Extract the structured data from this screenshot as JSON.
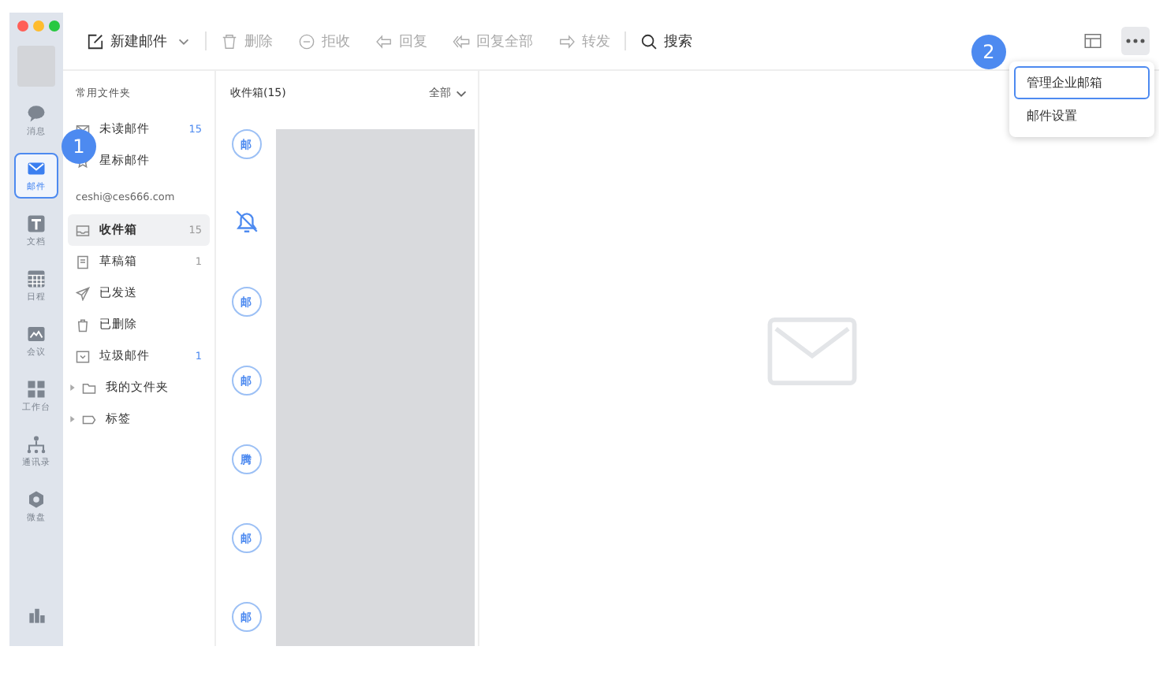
{
  "nav": [
    {
      "kind": "avatar"
    },
    {
      "kind": "chat",
      "label": "消息",
      "selected": false
    },
    {
      "kind": "mail",
      "label": "邮件",
      "selected": true
    },
    {
      "kind": "doc",
      "label": "文档",
      "selected": false
    },
    {
      "kind": "calendar",
      "label": "日程",
      "selected": false
    },
    {
      "kind": "meeting",
      "label": "会议",
      "selected": false
    },
    {
      "kind": "apps",
      "label": "工作台",
      "selected": false
    },
    {
      "kind": "contacts",
      "label": "通讯录",
      "selected": false
    },
    {
      "kind": "drive",
      "label": "微盘",
      "selected": false
    }
  ],
  "toolbar": {
    "compose": "新建邮件",
    "actions": [
      {
        "kind": "trash",
        "label": "删除",
        "disabled": true
      },
      {
        "kind": "block",
        "label": "拒收",
        "disabled": true
      },
      {
        "kind": "reply",
        "label": "回复",
        "disabled": true
      },
      {
        "kind": "replyall",
        "label": "回复全部",
        "disabled": true
      },
      {
        "kind": "forward",
        "label": "转发",
        "disabled": true
      }
    ],
    "search": "搜索"
  },
  "folders": {
    "common_heading": "常用文件夹",
    "common": [
      {
        "kind": "unread",
        "label": "未读邮件",
        "count": "15",
        "selected": false
      },
      {
        "kind": "star",
        "label": "星标邮件",
        "selected": false
      }
    ],
    "account": "ceshi@ces666.com",
    "items": [
      {
        "kind": "inbox",
        "label": "收件箱",
        "count": "15",
        "selected": true
      },
      {
        "kind": "draft",
        "label": "草稿箱",
        "count": "1",
        "selected": false
      },
      {
        "kind": "sent",
        "label": "已发送",
        "selected": false
      },
      {
        "kind": "deleted",
        "label": "已删除",
        "selected": false
      },
      {
        "kind": "spam",
        "label": "垃圾邮件",
        "count": "1",
        "selected": false
      }
    ],
    "groups": [
      {
        "kind": "folder",
        "label": "我的文件夹",
        "expanded": false
      },
      {
        "kind": "tag",
        "label": "标签",
        "expanded": false
      }
    ]
  },
  "list": {
    "title": "收件箱(15)",
    "filter": "全部",
    "senders": [
      {
        "kind": "text",
        "char": "邮"
      },
      {
        "kind": "bell"
      },
      {
        "kind": "text",
        "char": "邮"
      },
      {
        "kind": "text",
        "char": "邮"
      },
      {
        "kind": "text",
        "char": "腾"
      },
      {
        "kind": "text",
        "char": "邮"
      },
      {
        "kind": "text",
        "char": "邮"
      }
    ]
  },
  "menu": [
    {
      "label": "管理企业邮箱",
      "selected": true
    },
    {
      "label": "邮件设置",
      "selected": false
    }
  ],
  "steps": [
    "1",
    "2"
  ]
}
